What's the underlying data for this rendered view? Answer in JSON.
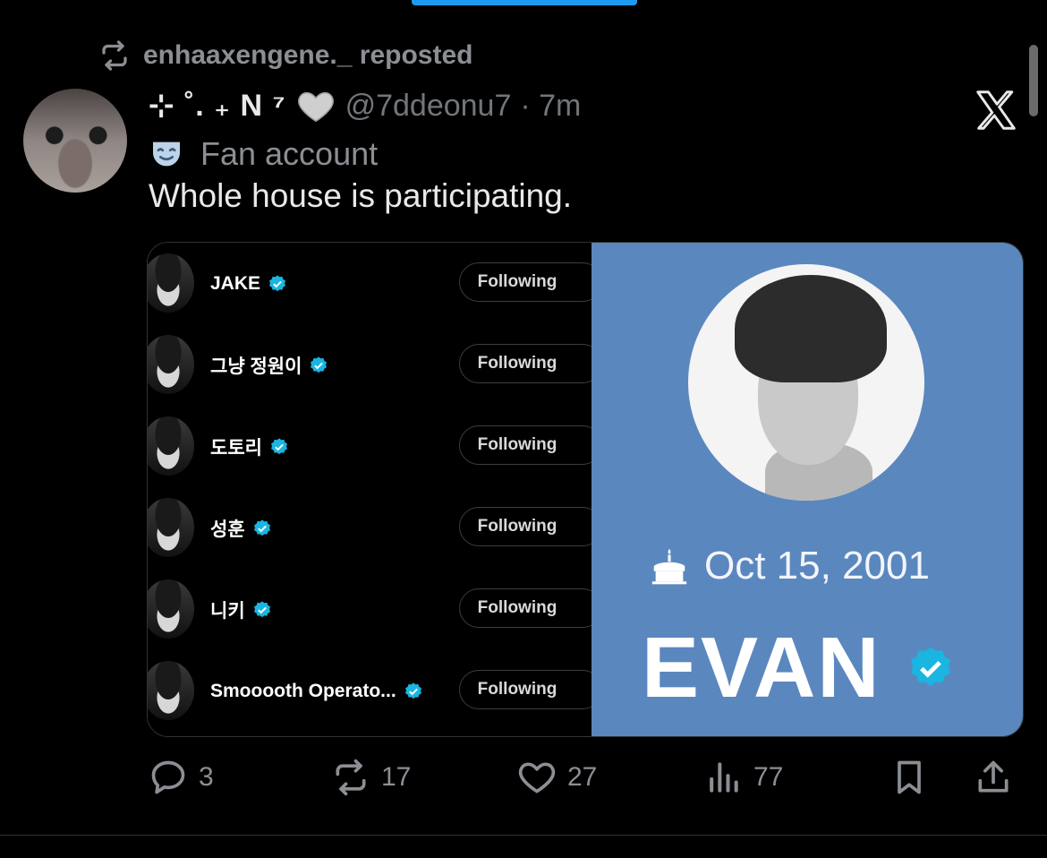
{
  "repost": {
    "text": "enhaaxengene._ reposted"
  },
  "author": {
    "display_name": "⊹ ˚. ₊ N ⁷",
    "handle": "@7ddeonu7",
    "time": "· 7m"
  },
  "badge": {
    "label": "Fan account"
  },
  "tweet": {
    "text": "Whole house is participating."
  },
  "media": {
    "follow_list": [
      {
        "name": "JAKE",
        "button": "Following"
      },
      {
        "name": "그냥 정원이",
        "button": "Following"
      },
      {
        "name": "도토리",
        "button": "Following"
      },
      {
        "name": "성훈",
        "button": "Following"
      },
      {
        "name": "니키",
        "button": "Following"
      },
      {
        "name": "Smooooth Operato...",
        "button": "Following"
      }
    ],
    "profile": {
      "birthday": "Oct 15, 2001",
      "name": "EVAN"
    }
  },
  "actions": {
    "replies": "3",
    "reposts": "17",
    "likes": "27",
    "views": "77"
  },
  "colors": {
    "accent": "#1d9bf0",
    "verified": "#1ab5e0",
    "panel": "#5b87bf"
  }
}
